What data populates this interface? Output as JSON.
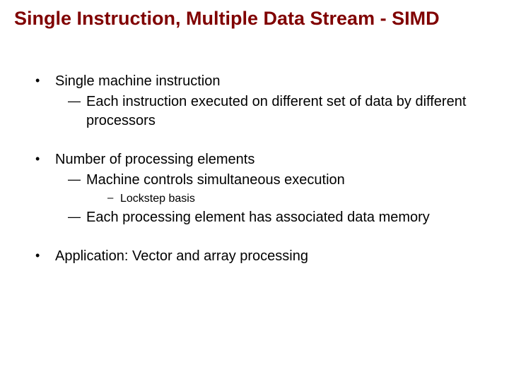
{
  "title": "Single Instruction, Multiple Data Stream - SIMD",
  "bullets": [
    {
      "text": "Single machine instruction",
      "children": [
        {
          "text": "Each instruction executed on different set of  data by different processors"
        }
      ]
    },
    {
      "text": "Number of processing elements",
      "children": [
        {
          "text": "Machine controls simultaneous execution",
          "children": [
            {
              "text": "Lockstep basis"
            }
          ]
        },
        {
          "text": "Each processing element has associated data memory"
        }
      ]
    },
    {
      "text": "Application: Vector and array processing"
    }
  ]
}
